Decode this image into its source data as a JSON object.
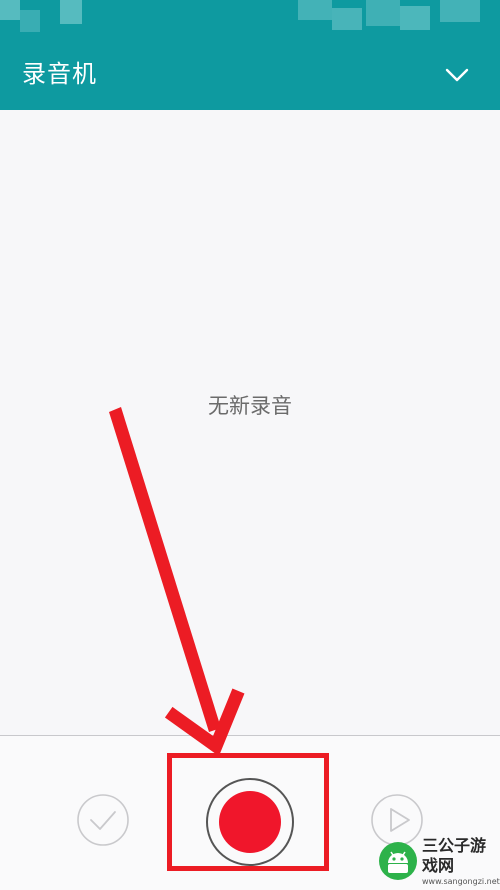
{
  "app_bar": {
    "title": "录音机",
    "menu_icon": "chevron-down-icon",
    "background": "#0e9aa0"
  },
  "main": {
    "empty_message": "无新录音"
  },
  "controls": {
    "done_icon": "check-icon",
    "record_icon": "record-icon",
    "play_icon": "play-icon",
    "record_color": "#f0162b"
  },
  "annotation": {
    "color": "#ec1c24",
    "shape": "arrow-and-box highlighting the record button"
  },
  "watermark": {
    "name": "三公子游戏网",
    "url": "www.sangongzi.net"
  }
}
